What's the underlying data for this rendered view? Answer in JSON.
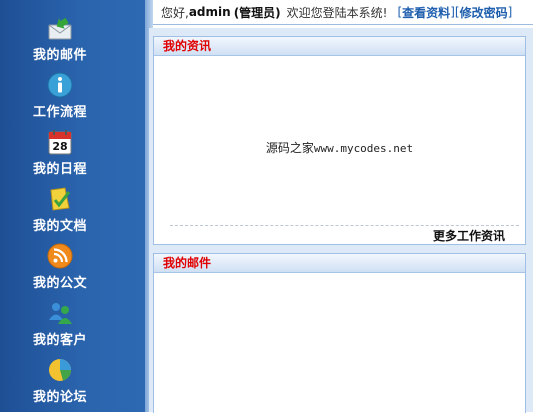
{
  "sidebar": {
    "items": [
      {
        "label": "我的邮件",
        "icon": "mail-icon"
      },
      {
        "label": "工作流程",
        "icon": "info-icon"
      },
      {
        "label": "我的日程",
        "icon": "calendar-icon",
        "icon_text": "28"
      },
      {
        "label": "我的文档",
        "icon": "document-icon"
      },
      {
        "label": "我的公文",
        "icon": "rss-icon"
      },
      {
        "label": "我的客户",
        "icon": "users-icon"
      },
      {
        "label": "我的论坛",
        "icon": "pie-icon"
      }
    ]
  },
  "header": {
    "greeting": "您好,",
    "username": "admin",
    "role": "(管理员)",
    "welcome": "欢迎您登陆本系统!",
    "bracket_open": "[",
    "sep": "][",
    "bracket_close": "]",
    "view_profile": "查看资料",
    "change_password": "修改密码"
  },
  "panels": {
    "info": {
      "title": "我的资讯",
      "watermark_cn": "源码之家",
      "watermark_url": "www.mycodes.net",
      "more_link": "更多工作资讯"
    },
    "mail": {
      "title": "我的邮件"
    }
  },
  "colors": {
    "sidebar": "#2a64ad",
    "panel_title": "#e00000",
    "link": "#1f5fae"
  }
}
